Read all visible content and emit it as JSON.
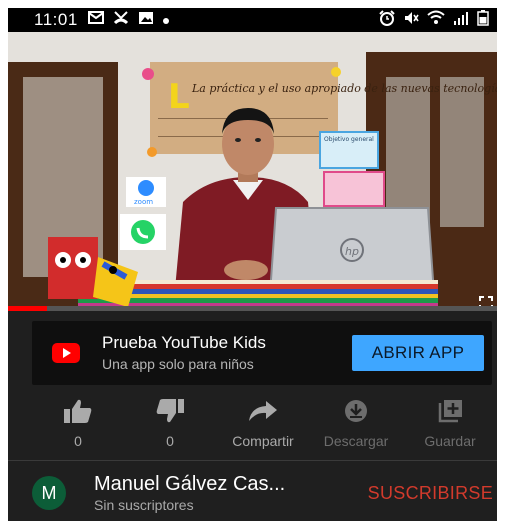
{
  "status_bar": {
    "time": "11:01",
    "left_icons": [
      "mail-icon",
      "missed-call-icon",
      "image-icon",
      "dot-icon"
    ],
    "right_icons": [
      "alarm-icon",
      "mute-icon",
      "wifi-icon",
      "signal-icon",
      "battery-icon"
    ]
  },
  "video": {
    "poster_text": "La práctica y el uso apropiado de las nuevas tecnologías",
    "card_label": "Objetivo general",
    "app_label": "zoom",
    "laptop_brand": "hp",
    "progress": 0.08
  },
  "kids_banner": {
    "title": "Prueba YouTube Kids",
    "subtitle": "Una app solo para niños",
    "button": "ABRIR APP"
  },
  "actions": [
    {
      "icon": "thumbs-up-icon",
      "label": "0"
    },
    {
      "icon": "thumbs-down-icon",
      "label": "0"
    },
    {
      "icon": "share-icon",
      "label": "Compartir"
    },
    {
      "icon": "download-icon",
      "label": "Descargar"
    },
    {
      "icon": "save-playlist-icon",
      "label": "Guardar"
    }
  ],
  "channel": {
    "avatar_letter": "M",
    "name": "Manuel Gálvez Cas...",
    "subscribers": "Sin suscriptores",
    "subscribe_button": "SUSCRIBIRSE"
  },
  "colors": {
    "background": "#1f1f1f",
    "banner_button": "#3ea6ff",
    "subscribe": "#d23a2c",
    "progress": "#ff0000",
    "avatar": "#0c5d38"
  }
}
